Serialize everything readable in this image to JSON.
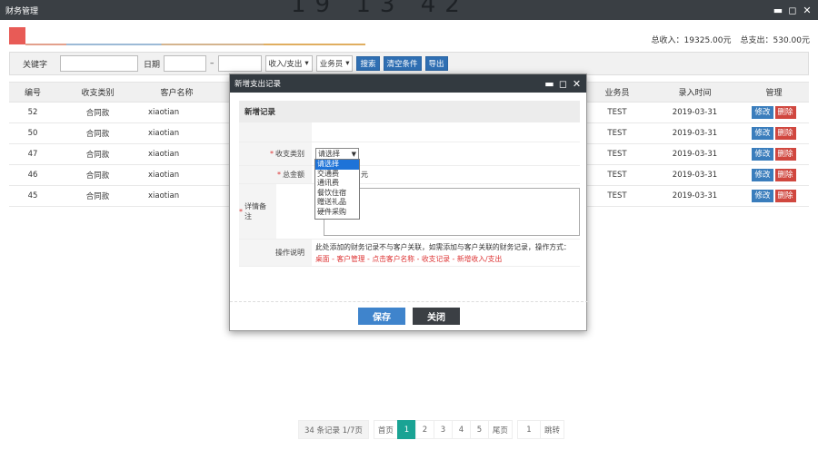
{
  "window": {
    "title": "财务管理",
    "controls": [
      "▬",
      "◻",
      "✕"
    ]
  },
  "watermark": "19 13 42",
  "totals": {
    "income": "总收入：19325.00元",
    "expense": "总支出：530.00元"
  },
  "filter": {
    "keyword_label": "关键字",
    "date_label": "日期",
    "date_sep": "–",
    "type_select": "收入/支出",
    "staff_select": "业务员",
    "search_btn": "搜索",
    "clear_btn": "清空条件",
    "export_btn": "导出"
  },
  "table": {
    "headers": [
      "编号",
      "收支类别",
      "客户名称",
      "",
      "业务员",
      "录入时间",
      "管理"
    ],
    "rows": [
      {
        "id": "52",
        "type": "合同款",
        "customer": "xiaotian",
        "staff": "TEST",
        "date": "2019-03-31"
      },
      {
        "id": "50",
        "type": "合同款",
        "customer": "xiaotian",
        "staff": "TEST",
        "date": "2019-03-31"
      },
      {
        "id": "47",
        "type": "合同款",
        "customer": "xiaotian",
        "staff": "TEST",
        "date": "2019-03-31"
      },
      {
        "id": "46",
        "type": "合同款",
        "customer": "xiaotian",
        "staff": "TEST",
        "date": "2019-03-31"
      },
      {
        "id": "45",
        "type": "合同款",
        "customer": "xiaotian",
        "staff": "TEST",
        "date": "2019-03-31"
      }
    ],
    "edit_label": "修改",
    "delete_label": "删除"
  },
  "pager": {
    "info": "34 条记录 1/7页",
    "first": "首页",
    "pages": [
      "1",
      "2",
      "3",
      "4",
      "5"
    ],
    "last": "尾页",
    "jump_input": "1",
    "jump": "跳转"
  },
  "modal": {
    "title": "新增支出记录",
    "controls": [
      "▬",
      "◻",
      "✕"
    ],
    "section": "新增记录",
    "type_label": "收支类别",
    "type_value": "请选择",
    "amount_label": "总金额",
    "amount_unit": "元",
    "remark_label": "详情备注",
    "note_label": "操作说明",
    "note_text": "此处添加的财务记录不与客户关联，如需添加与客户关联的财务记录，操作方式：",
    "note_links": "桌面 - 客户管理 - 点击客户名称 - 收支记录 - 新增收入/支出",
    "dropdown_options": [
      "请选择",
      "交通费",
      "通讯费",
      "餐饮住宿",
      "赠送礼品",
      "硬件采购"
    ],
    "save": "保存",
    "close": "关闭"
  },
  "colors": {
    "titlebar": "#3a3f44",
    "accent": "#2f6fb3",
    "danger": "#d0473f",
    "pager_active": "#1aa394"
  }
}
